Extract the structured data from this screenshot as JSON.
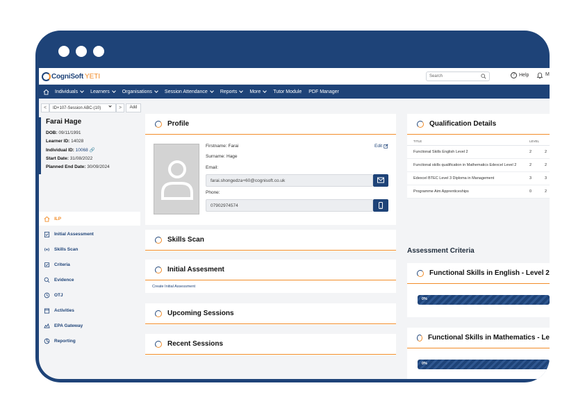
{
  "app": {
    "logo_text": "CogniSoft",
    "logo_accent": "YETI"
  },
  "header": {
    "search_placeholder": "Search",
    "help_label": "Help",
    "cut_label": "M"
  },
  "nav": {
    "items": [
      {
        "label": "Individuals",
        "dropdown": true
      },
      {
        "label": "Learners",
        "dropdown": true
      },
      {
        "label": "Organisations",
        "dropdown": true
      },
      {
        "label": "Session Attendance",
        "dropdown": true
      },
      {
        "label": "Reports",
        "dropdown": true
      },
      {
        "label": "More",
        "dropdown": true
      },
      {
        "label": "Tutor Module",
        "dropdown": false
      },
      {
        "label": "PDF Manager",
        "dropdown": false
      }
    ]
  },
  "selector": {
    "prev": "<",
    "next": ">",
    "value": "ID+107-Session ABC-(10)",
    "add_label": "Add"
  },
  "learner": {
    "name": "Farai Hage",
    "dob_label": "DOB:",
    "dob": "09/11/1991",
    "learner_id_label": "Learner ID:",
    "learner_id": "14028",
    "individual_id_label": "Individual ID:",
    "individual_id": "10068",
    "start_label": "Start Date:",
    "start_date": "31/08/2022",
    "end_label": "Planned End Date:",
    "end_date": "30/09/2024"
  },
  "side_menu": [
    {
      "label": "ILP",
      "icon": "home-icon",
      "active": true
    },
    {
      "label": "Initial Assessment",
      "icon": "clipboard-check-icon",
      "active": false
    },
    {
      "label": "Skills Scan",
      "icon": "radio-icon",
      "active": false
    },
    {
      "label": "Criteria",
      "icon": "checklist-icon",
      "active": false
    },
    {
      "label": "Evidence",
      "icon": "search-icon",
      "active": false
    },
    {
      "label": "OTJ",
      "icon": "clock-icon",
      "active": false
    },
    {
      "label": "Activities",
      "icon": "calendar-icon",
      "active": false
    },
    {
      "label": "EPA Gateway",
      "icon": "gateway-icon",
      "active": false
    },
    {
      "label": "Reporting",
      "icon": "chart-pie-icon",
      "active": false
    }
  ],
  "profile": {
    "title": "Profile",
    "edit_label": "Edit",
    "firstname_label": "Firstname:",
    "firstname": "Farai",
    "surname_label": "Surname:",
    "surname": "Hage",
    "email_label": "Email:",
    "email": "farai.shongedza+60@cognisoft.co.uk",
    "phone_label": "Phone:",
    "phone": "07902974574"
  },
  "cards": {
    "skills_scan": "Skills Scan",
    "initial_assessment": "Initial Assesment",
    "create_initial_assessment": "Create Initial Assessment",
    "upcoming_sessions": "Upcoming Sessions",
    "recent_sessions": "Recent Sessions"
  },
  "qualifications": {
    "title": "Qualification Details",
    "headers": {
      "title": "TITLE",
      "level": "LEVEL",
      "cut": ""
    },
    "rows": [
      {
        "title": "Functional Skills English Level 2",
        "level": "2",
        "cut": "2"
      },
      {
        "title": "Functional skills qualification in Mathematics Edexcel Level 2",
        "level": "2",
        "cut": "2"
      },
      {
        "title": "Edexcel BTEC Level 3 Diploma in Management",
        "level": "3",
        "cut": "3"
      },
      {
        "title": "Programme Aim Apprenticeships",
        "level": "0",
        "cut": "2"
      }
    ]
  },
  "assessment_criteria": {
    "label": "Assessment Criteria",
    "items": [
      {
        "title": "Functional Skills in English - Level 2",
        "progress": "0%"
      },
      {
        "title": "Functional Skills in Mathematics - Le",
        "progress": "0%"
      }
    ]
  },
  "colors": {
    "brand": "#1e4378",
    "accent": "#f28c28",
    "background": "#f3f4f6"
  }
}
